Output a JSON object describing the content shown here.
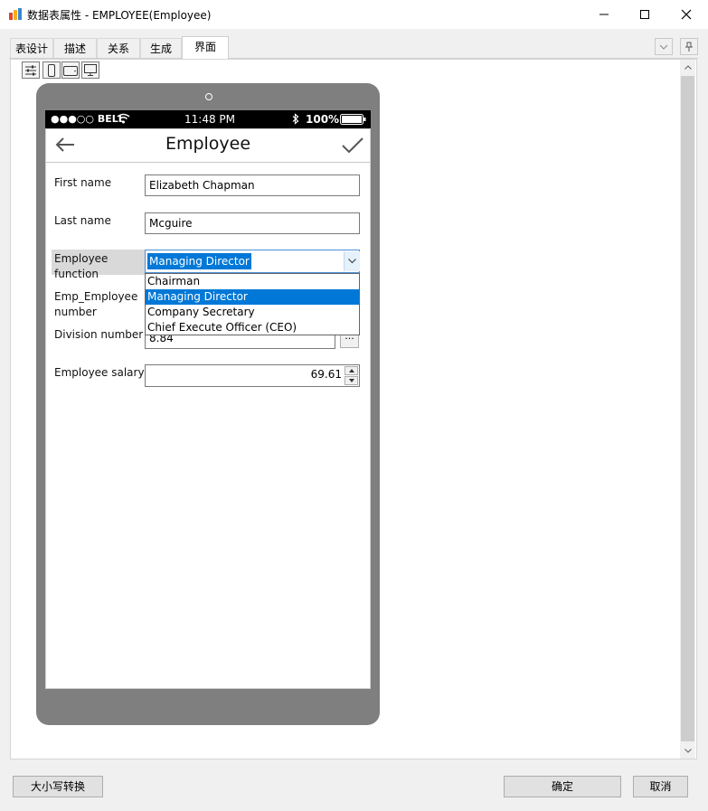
{
  "window": {
    "title": "数据表属性 - EMPLOYEE(Employee)"
  },
  "tabs": [
    {
      "label": "表设计"
    },
    {
      "label": "描述"
    },
    {
      "label": "关系"
    },
    {
      "label": "生成"
    },
    {
      "label": "界面",
      "active": true
    }
  ],
  "toolbar_icons": [
    "settings-sliders-icon",
    "phone-portrait-icon",
    "tablet-landscape-icon",
    "desktop-monitor-icon"
  ],
  "phone": {
    "status": {
      "carrier": "●●●○○ BELL",
      "time": "11:48 PM",
      "battery": "100%"
    },
    "nav_title": "Employee",
    "fields": {
      "first_name": {
        "label": "First name",
        "value": "Elizabeth Chapman"
      },
      "last_name": {
        "label": "Last name",
        "value": "Mcguire"
      },
      "employee_function": {
        "label_line1": "Employee",
        "label_line2": "function",
        "selected": "Managing Director",
        "options": [
          "Chairman",
          "Managing Director",
          "Company Secretary",
          "Chief Execute Officer (CEO)"
        ]
      },
      "emp_employee_number": {
        "label_line1": "Emp_Employee",
        "label_line2": "number"
      },
      "division_number": {
        "label": "Division number",
        "value": "8.84",
        "button": "..."
      },
      "employee_salary": {
        "label": "Employee salary",
        "value": "69.61"
      }
    }
  },
  "buttons": {
    "case_convert": "大小写转换",
    "ok": "确定",
    "cancel": "取消"
  },
  "colors": {
    "selection": "#0078d7",
    "phone_frame": "#7f7f7f"
  }
}
